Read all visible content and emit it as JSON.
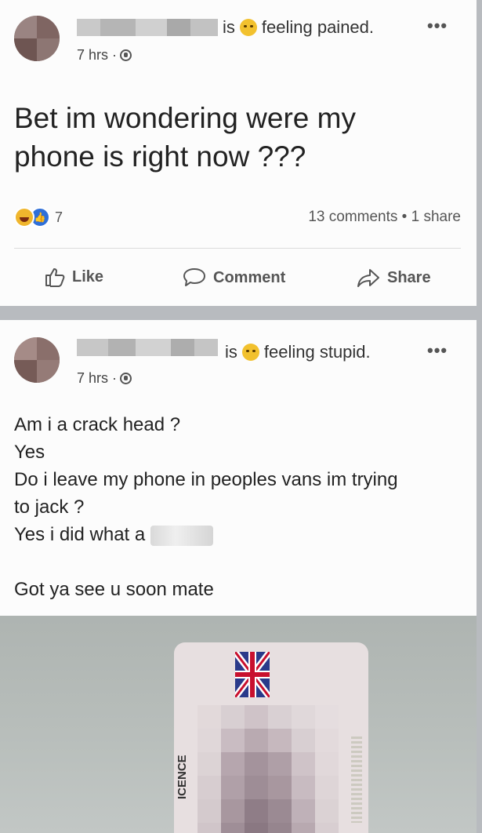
{
  "post1": {
    "is_label": "is",
    "feeling": "feeling pained.",
    "feeling_emoji_icon": "pained-face-icon",
    "time": "7 hrs ·",
    "menu": "•••",
    "body_lines": [
      "Bet im wondering were my",
      "phone is right now ???"
    ],
    "reaction_count": "7",
    "stats": "13 comments • 1 share",
    "actions": {
      "like": "Like",
      "comment": "Comment",
      "share": "Share"
    }
  },
  "post2": {
    "is_label": "is",
    "feeling": "feeling stupid.",
    "feeling_emoji_icon": "stupid-face-icon",
    "time": "7 hrs ·",
    "menu": "•••",
    "body_lines": [
      "Am i a crack head ?",
      "Yes",
      "Do i leave my phone in peoples vans im trying",
      "to jack ?",
      "Yes i did what a",
      "",
      "Got ya see u soon mate"
    ]
  },
  "photo": {
    "licence_text": "ICENCE"
  },
  "colors": {
    "accent": "#2f6fd8",
    "card": "#fcfcfc",
    "separator": "#b8bbbf"
  }
}
